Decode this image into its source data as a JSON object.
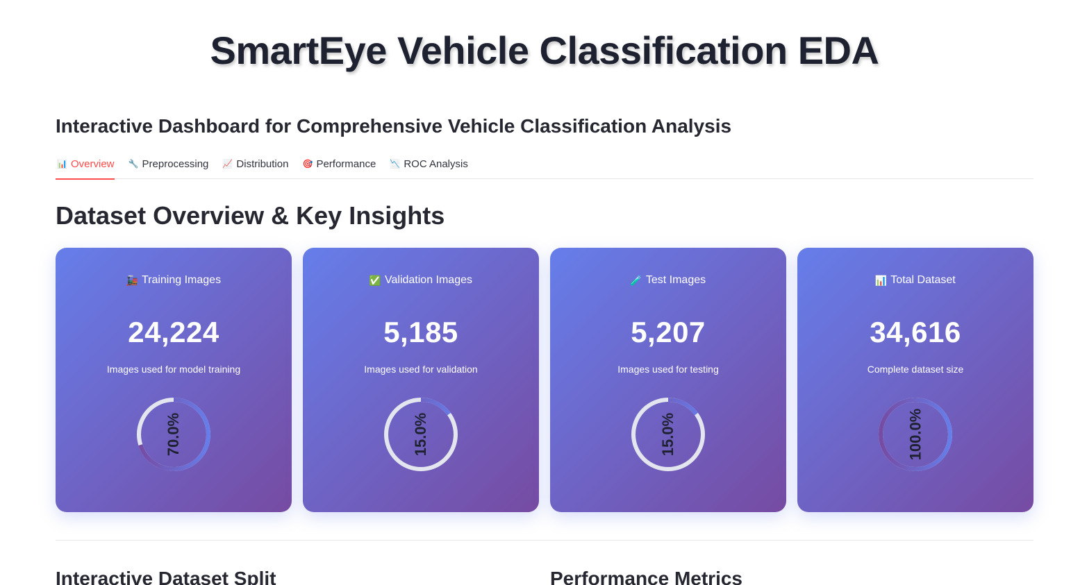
{
  "header": {
    "title": "SmartEye Vehicle Classification EDA",
    "subtitle": "Interactive Dashboard for Comprehensive Vehicle Classification Analysis"
  },
  "tabs": [
    {
      "icon": "📊",
      "label": "Overview",
      "active": true
    },
    {
      "icon": "🔧",
      "label": "Preprocessing",
      "active": false
    },
    {
      "icon": "📈",
      "label": "Distribution",
      "active": false
    },
    {
      "icon": "🎯",
      "label": "Performance",
      "active": false
    },
    {
      "icon": "📉",
      "label": "ROC Analysis",
      "active": false
    }
  ],
  "section": {
    "title": "Dataset Overview & Key Insights"
  },
  "cards": [
    {
      "icon": "🚂",
      "label": "Training Images",
      "value": "24,224",
      "desc": "Images used for model training",
      "percent_label": "70.0%",
      "fraction": 0.7
    },
    {
      "icon": "✅",
      "label": "Validation Images",
      "value": "5,185",
      "desc": "Images used for validation",
      "percent_label": "15.0%",
      "fraction": 0.15
    },
    {
      "icon": "🧪",
      "label": "Test Images",
      "value": "5,207",
      "desc": "Images used for testing",
      "percent_label": "15.0%",
      "fraction": 0.15
    },
    {
      "icon": "📊",
      "label": "Total Dataset",
      "value": "34,616",
      "desc": "Complete dataset size",
      "percent_label": "100.0%",
      "fraction": 1.0
    }
  ],
  "bottom": {
    "left_title": "Interactive Dataset Split",
    "right_title": "Performance Metrics"
  },
  "colors": {
    "accent": "#ff4b4b",
    "gradient_start": "#667eea",
    "gradient_end": "#764ba2"
  }
}
